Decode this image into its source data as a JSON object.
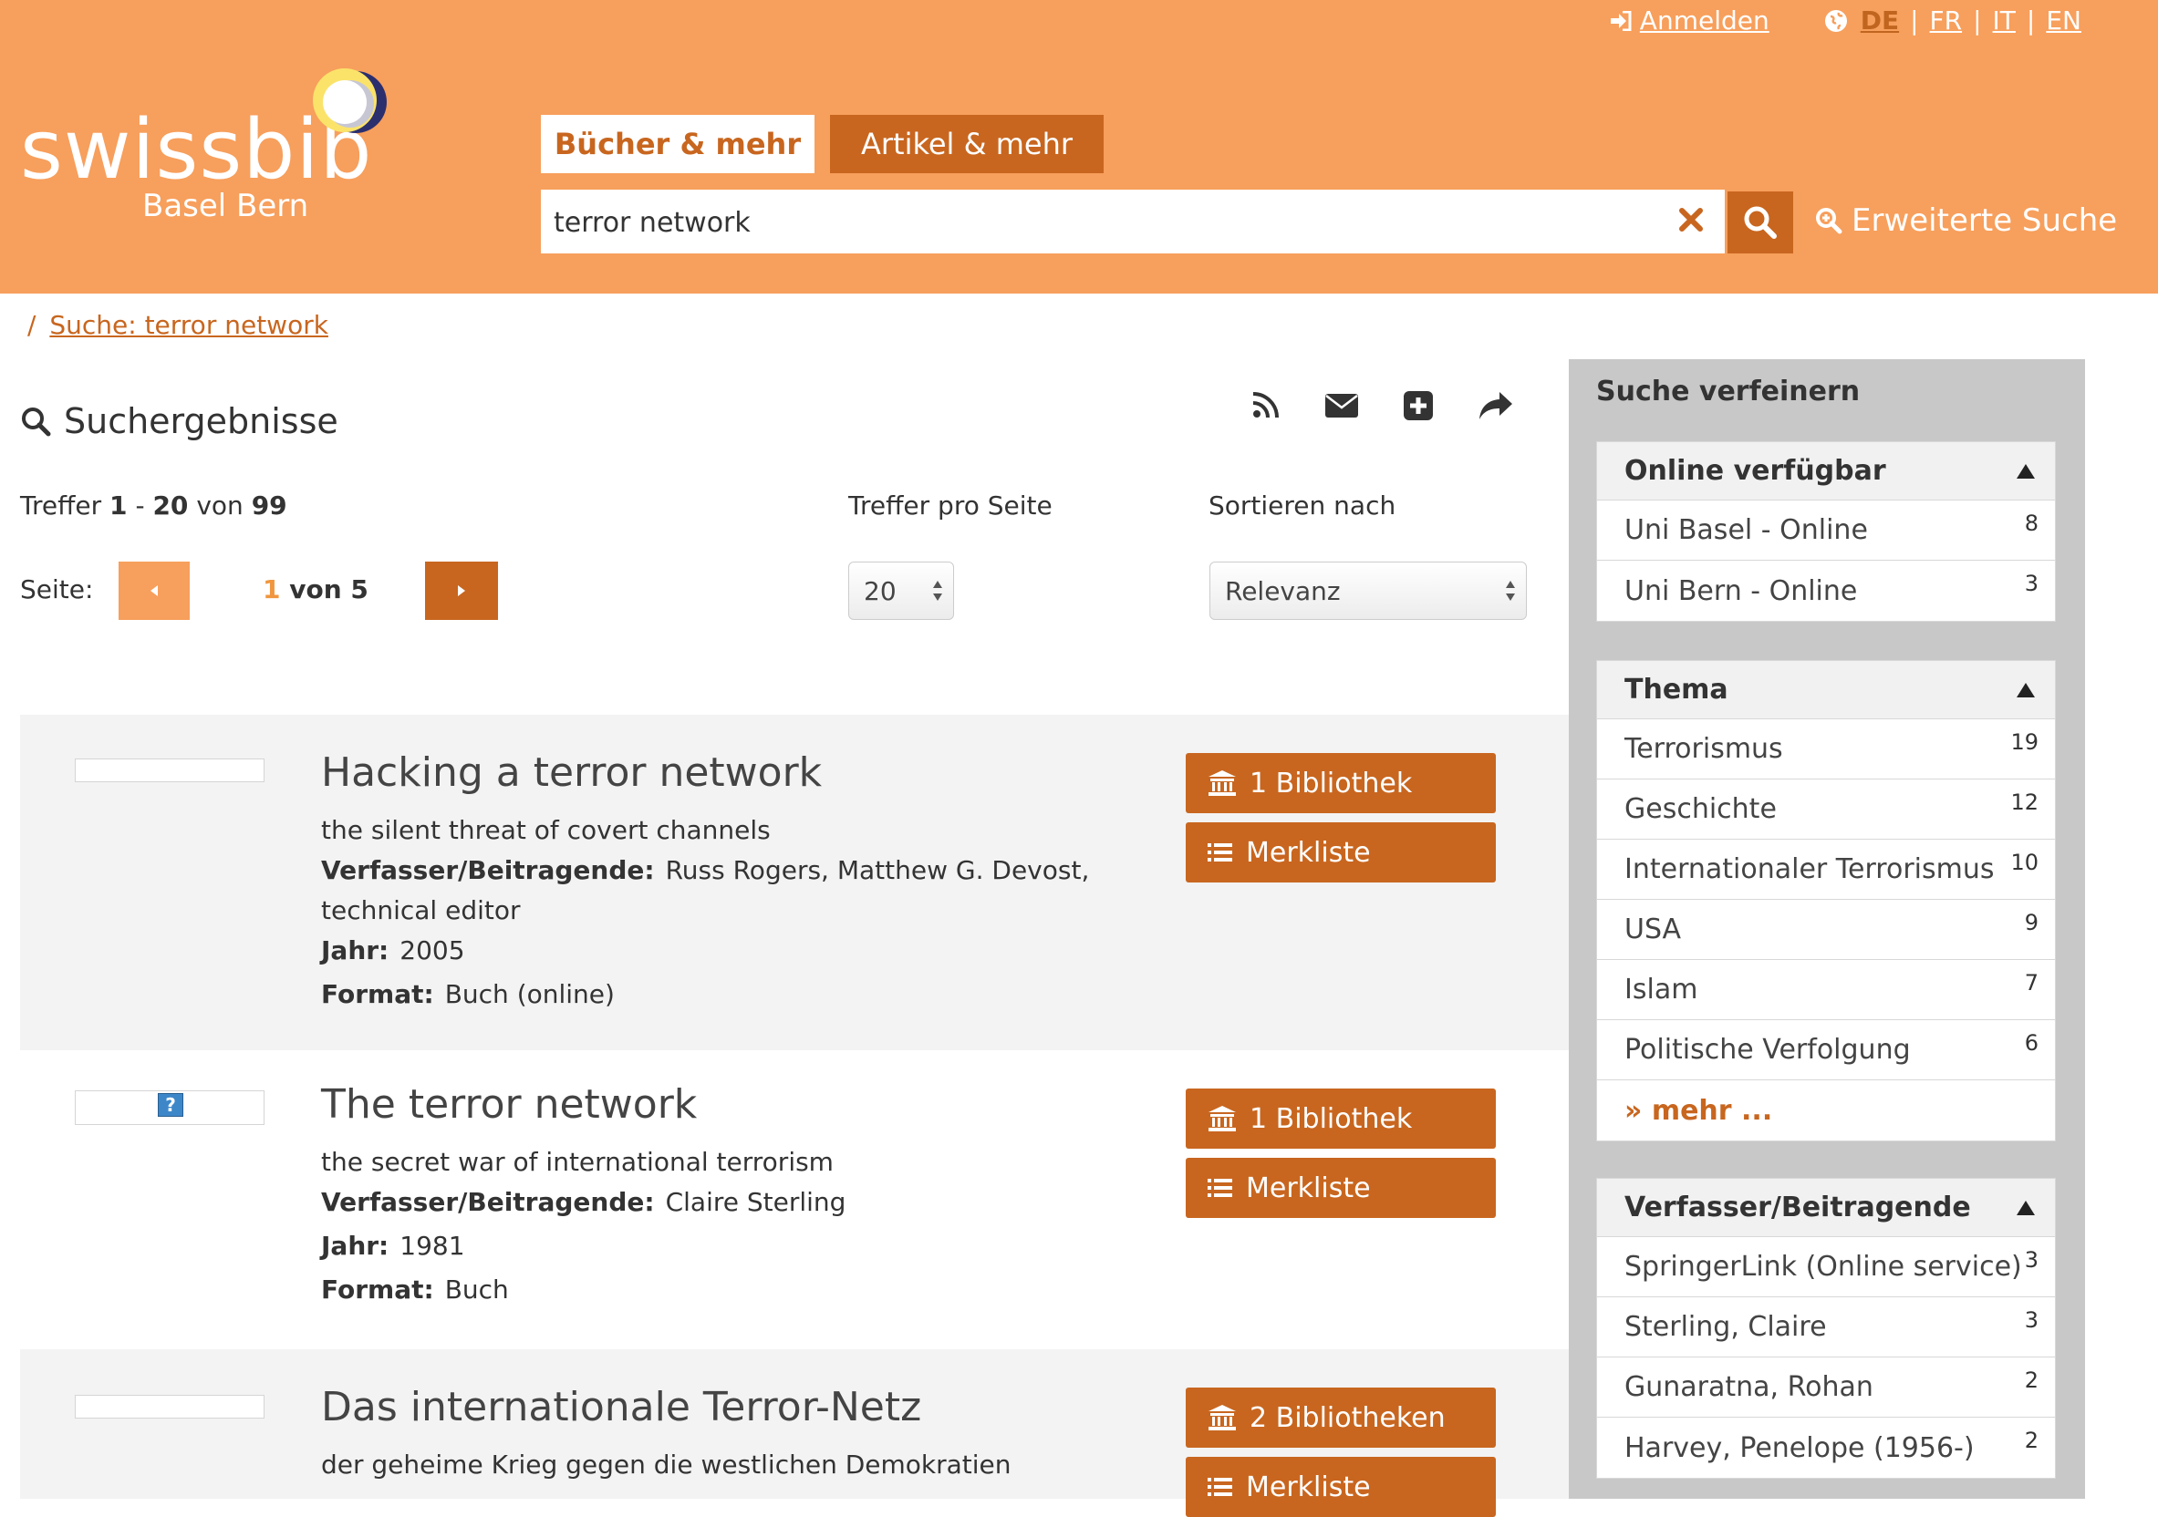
{
  "header": {
    "login_label": "Anmelden",
    "languages": [
      "DE",
      "FR",
      "IT",
      "EN"
    ],
    "active_language": "DE",
    "logo_text": "swissbib",
    "logo_subtitle": "Basel Bern",
    "tabs": [
      "Bücher & mehr",
      "Artikel & mehr"
    ],
    "search_value": "terror network",
    "advanced_search_label": "Erweiterte Suche"
  },
  "breadcrumb": {
    "separator": "/",
    "link": "Suche: terror network"
  },
  "results": {
    "heading": "Suchergebnisse",
    "hits_prefix": "Treffer",
    "hits_from": "1",
    "hits_dash": "-",
    "hits_to": "20",
    "hits_of": "von",
    "hits_total": "99",
    "per_page_label": "Treffer pro Seite",
    "per_page_value": "20",
    "sort_label": "Sortieren nach",
    "sort_value": "Relevanz",
    "page_label": "Seite:",
    "page_current": "1",
    "page_of": "von 5",
    "tool_icons": [
      "rss-icon",
      "envelope-icon",
      "plus-square-icon",
      "share-icon"
    ],
    "items": [
      {
        "title": "Hacking a terror network",
        "subtitle": "the silent threat of covert channels",
        "authors_label": "Verfasser/Beitragende:",
        "authors_line1": "Russ Rogers, Matthew G. Devost,",
        "authors_line2": "technical editor",
        "year_label": "Jahr:",
        "year": "2005",
        "format_label": "Format:",
        "format": "Buch (online)",
        "library_button": "1 Bibliothek",
        "list_button": "Merkliste"
      },
      {
        "title": "The terror network",
        "subtitle": "the secret war of international terrorism",
        "authors_label": "Verfasser/Beitragende:",
        "authors_line1": "Claire Sterling",
        "year_label": "Jahr:",
        "year": "1981",
        "format_label": "Format:",
        "format": "Buch",
        "library_button": "1 Bibliothek",
        "list_button": "Merkliste",
        "cover_placeholder": "?"
      },
      {
        "title": "Das internationale Terror-Netz",
        "subtitle": "der geheime Krieg gegen die westlichen Demokratien",
        "library_button": "2 Bibliotheken",
        "list_button": "Merkliste"
      }
    ]
  },
  "sidebar": {
    "title": "Suche verfeinern",
    "facets": [
      {
        "heading": "Online verfügbar",
        "items": [
          {
            "label": "Uni Basel - Online",
            "count": "8"
          },
          {
            "label": "Uni Bern - Online",
            "count": "3"
          }
        ]
      },
      {
        "heading": "Thema",
        "items": [
          {
            "label": "Terrorismus",
            "count": "19"
          },
          {
            "label": "Geschichte",
            "count": "12"
          },
          {
            "label": "Internationaler Terrorismus",
            "count": "10"
          },
          {
            "label": "USA",
            "count": "9"
          },
          {
            "label": "Islam",
            "count": "7"
          },
          {
            "label": "Politische Verfolgung",
            "count": "6"
          }
        ],
        "more": "» mehr ..."
      },
      {
        "heading": "Verfasser/Beitragende",
        "items": [
          {
            "label": "SpringerLink (Online service)",
            "count": "3"
          },
          {
            "label": "Sterling, Claire",
            "count": "3"
          },
          {
            "label": "Gunaratna, Rohan",
            "count": "2"
          },
          {
            "label": "Harvey, Penelope (1956-)",
            "count": "2"
          }
        ]
      }
    ]
  },
  "colors": {
    "header_bg": "#f79f5c",
    "accent": "#c8661f",
    "sidebar_bg": "#c8c8c8",
    "result_shade": "#f3f3f3"
  }
}
